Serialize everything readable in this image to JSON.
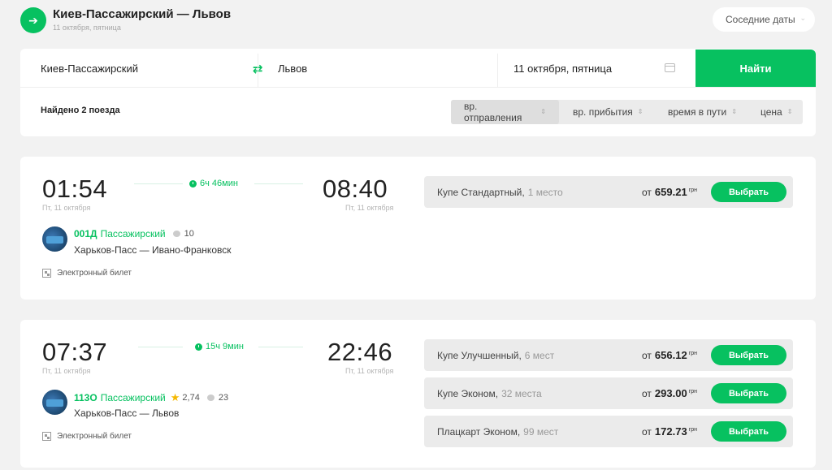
{
  "header": {
    "title": "Киев-Пассажирский — Львов",
    "subtitle": "11 октября, пятница",
    "nearby_dates": "Соседние даты"
  },
  "search": {
    "from": "Киев-Пассажирский",
    "to": "Львов",
    "date": "11 октября, пятница",
    "find_label": "Найти",
    "found": "Найдено 2 поезда",
    "sort": [
      "вр. отправления",
      "вр. прибытия",
      "время в пути",
      "цена"
    ]
  },
  "trains": [
    {
      "dep_time": "01:54",
      "dep_date": "Пт, 11 октября",
      "duration": "6ч 46мин",
      "arr_time": "08:40",
      "arr_date": "Пт, 11 октября",
      "number": "001Д",
      "type": "Пассажирский",
      "rating": "",
      "reviews": "10",
      "route": "Харьков-Пасс — Ивано-Франковск",
      "eticket": "Электронный билет",
      "fares": [
        {
          "class": "Купе Стандартный,",
          "seats": "1 место",
          "from": "от",
          "price": "659.21",
          "currency": "грн",
          "button": "Выбрать"
        }
      ]
    },
    {
      "dep_time": "07:37",
      "dep_date": "Пт, 11 октября",
      "duration": "15ч 9мин",
      "arr_time": "22:46",
      "arr_date": "Пт, 11 октября",
      "number": "113О",
      "type": "Пассажирский",
      "rating": "2,74",
      "reviews": "23",
      "route": "Харьков-Пасс — Львов",
      "eticket": "Электронный билет",
      "fares": [
        {
          "class": "Купе Улучшенный,",
          "seats": "6 мест",
          "from": "от",
          "price": "656.12",
          "currency": "грн",
          "button": "Выбрать"
        },
        {
          "class": "Купе Эконом,",
          "seats": "32 места",
          "from": "от",
          "price": "293.00",
          "currency": "грн",
          "button": "Выбрать"
        },
        {
          "class": "Плацкарт Эконом,",
          "seats": "99 мест",
          "from": "от",
          "price": "172.73",
          "currency": "грн",
          "button": "Выбрать"
        }
      ]
    }
  ]
}
